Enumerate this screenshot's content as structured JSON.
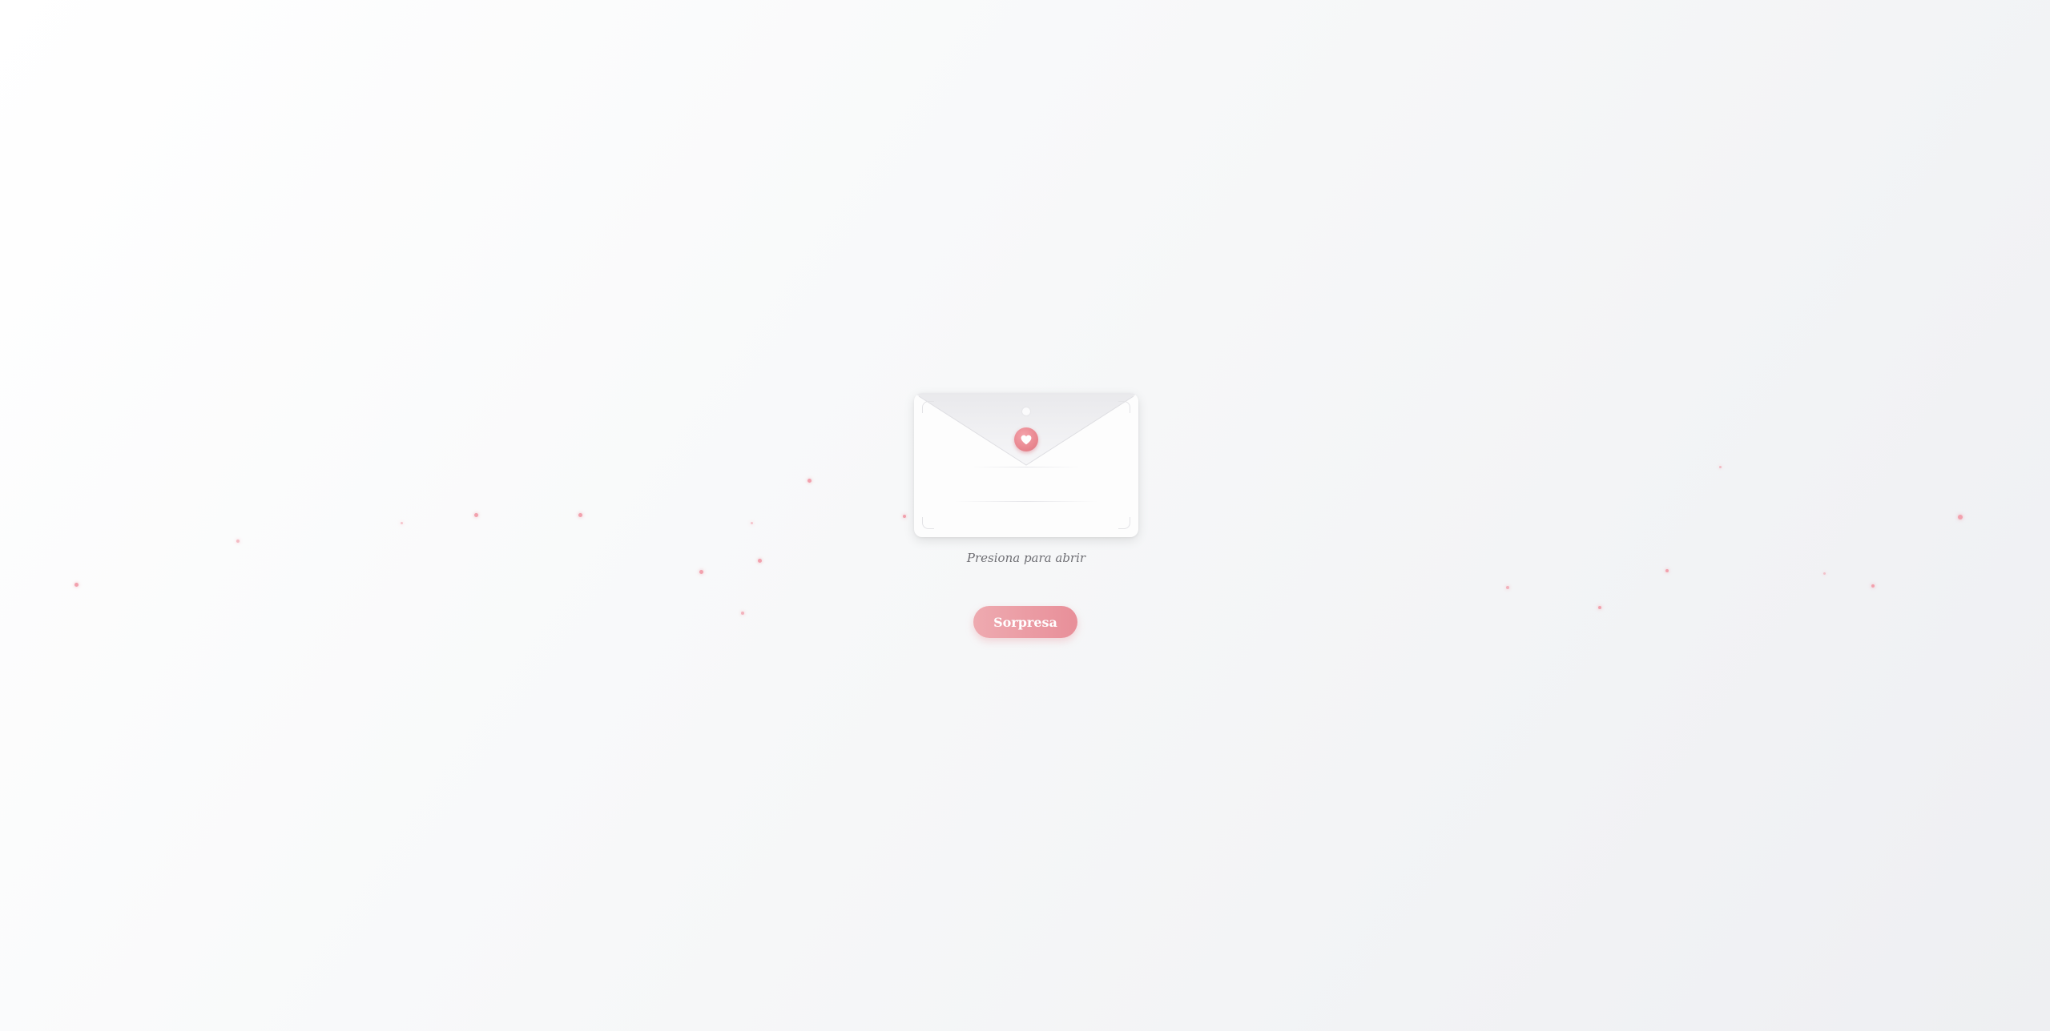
{
  "envelope": {
    "hint": "Presiona para abrir",
    "seal_icon": "heart-icon"
  },
  "button": {
    "label": "Sorpresa"
  },
  "colors": {
    "accent": "#e88f99",
    "accent_light": "#eeaab0",
    "particle": "#f2a1ad",
    "hint_text": "#6f6f74",
    "background_light": "#ffffff",
    "background_dark": "#eeeff2"
  }
}
